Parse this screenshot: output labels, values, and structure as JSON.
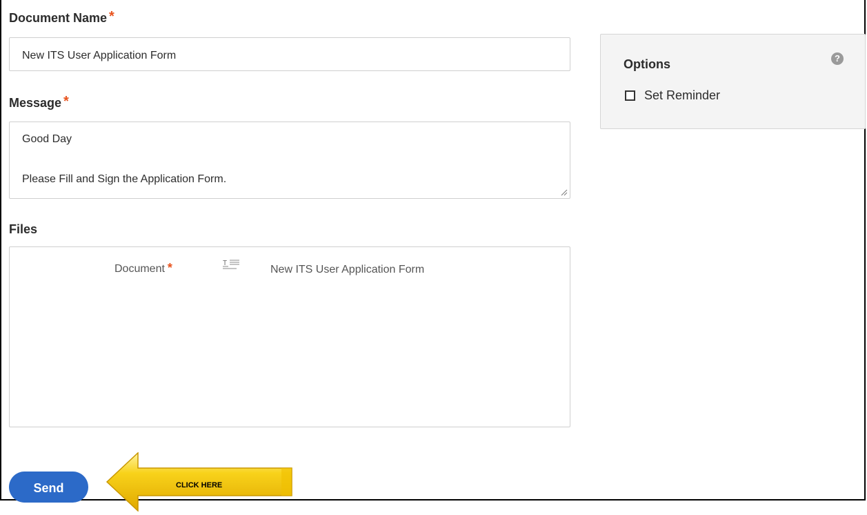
{
  "form": {
    "document_name": {
      "label": "Document Name",
      "required_mark": "*",
      "value": "New ITS User Application Form"
    },
    "message": {
      "label": "Message",
      "required_mark": "*",
      "line1": "Good Day",
      "line2": "Please Fill and Sign the Application Form."
    },
    "files": {
      "label": "Files",
      "document_label": "Document",
      "required_mark": "*",
      "file_name": "New ITS User Application Form"
    },
    "send_label": "Send"
  },
  "options": {
    "title": "Options",
    "help_icon": "?",
    "set_reminder_label": "Set Reminder",
    "set_reminder_checked": false
  },
  "annotation": {
    "arrow_text": "CLICK HERE",
    "arrow_color": "#f5c400"
  },
  "colors": {
    "accent": "#2c6ac8",
    "required": "#e8531e",
    "panel_bg": "#f4f4f4"
  }
}
